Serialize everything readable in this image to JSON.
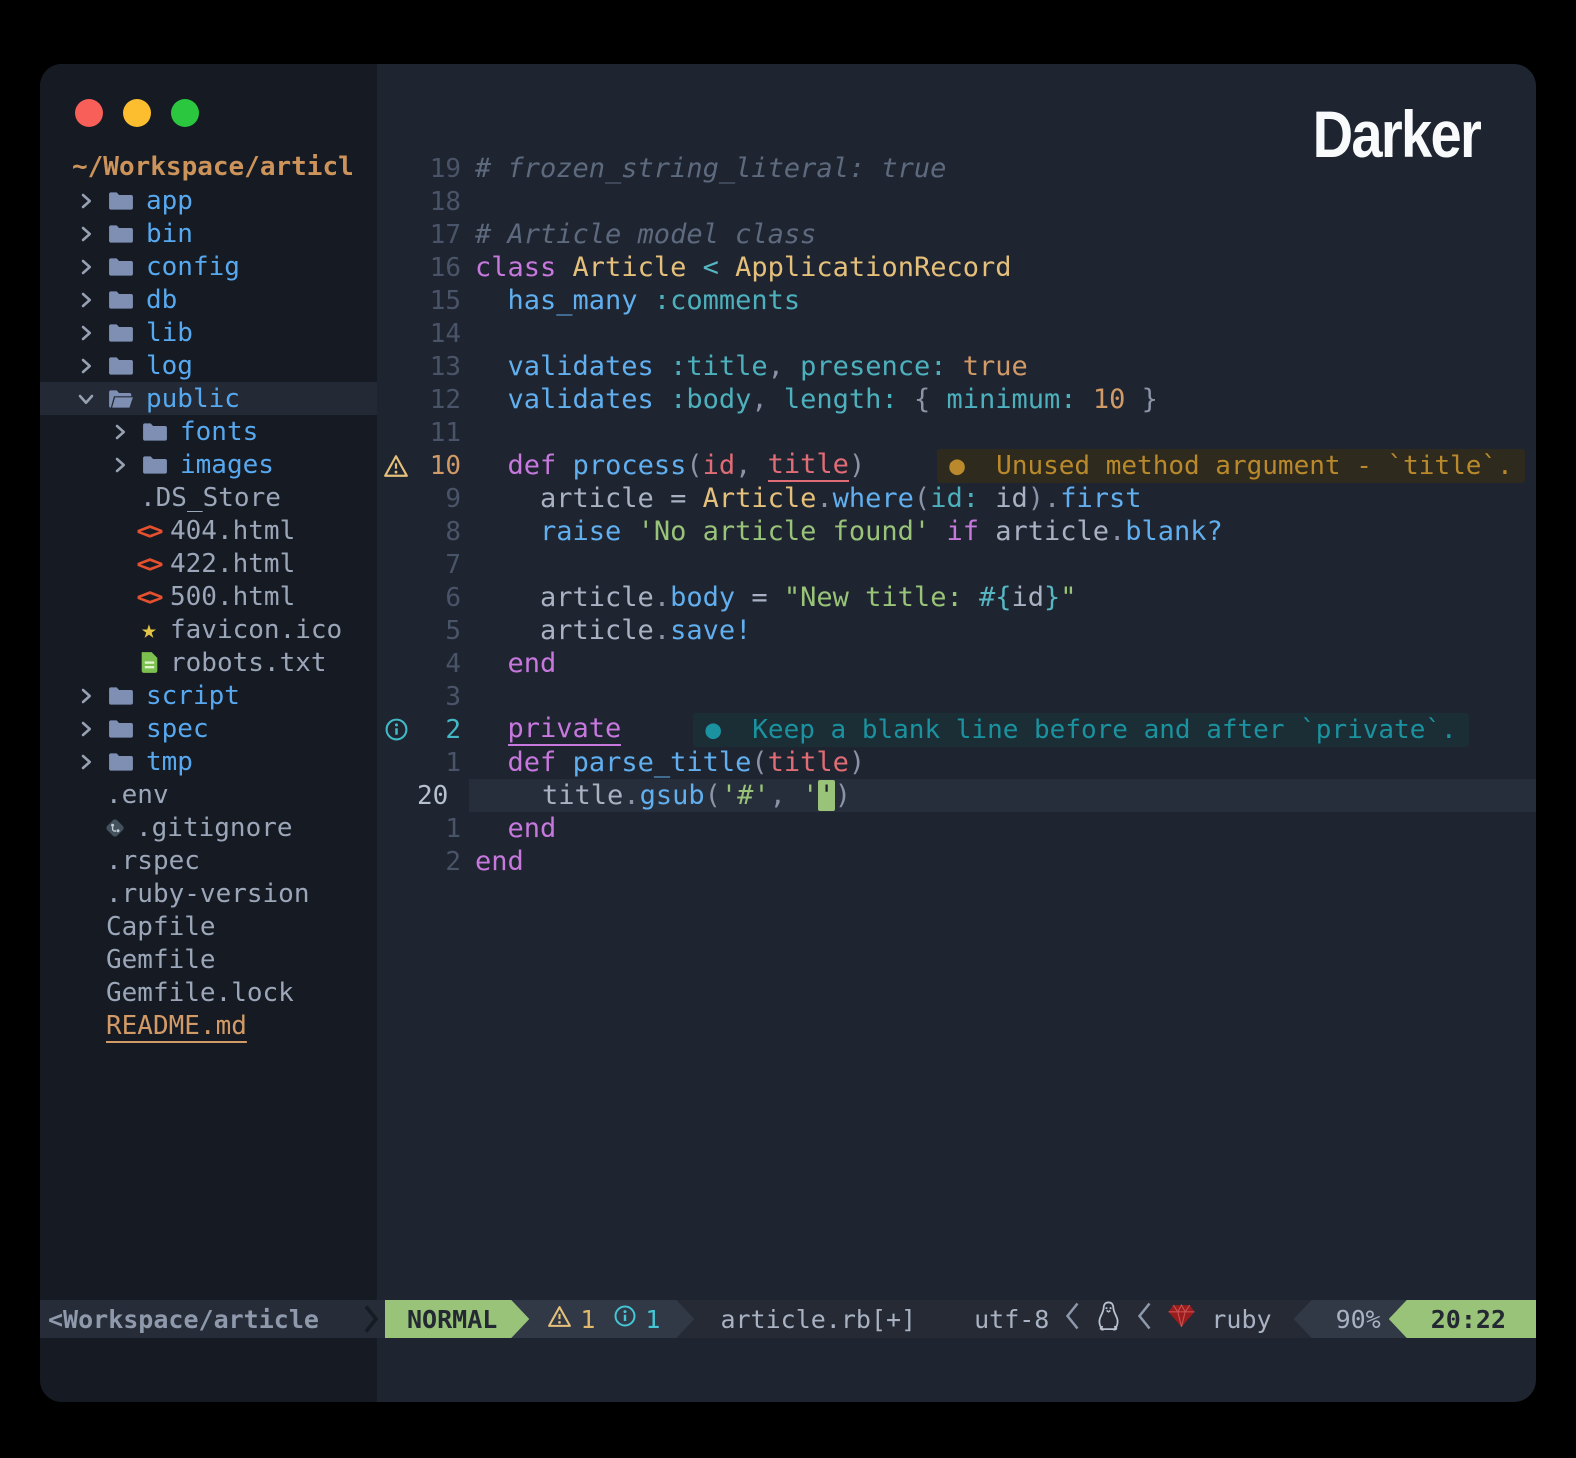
{
  "window": {
    "title": "Darker"
  },
  "colors": {
    "accent_green": "#98c379",
    "warning": "#e5c07b",
    "info": "#41bac8",
    "error_red": "#e06c75",
    "folder_blue": "#57a8ee",
    "ruby_red": "#9b1c1c",
    "root_orange": "#cc935a"
  },
  "sidebar": {
    "root": "~/Workspace/articl",
    "items": [
      {
        "label": "app",
        "kind": "folder",
        "depth": 1
      },
      {
        "label": "bin",
        "kind": "folder",
        "depth": 1
      },
      {
        "label": "config",
        "kind": "folder",
        "depth": 1
      },
      {
        "label": "db",
        "kind": "folder",
        "depth": 1
      },
      {
        "label": "lib",
        "kind": "folder",
        "depth": 1
      },
      {
        "label": "log",
        "kind": "folder",
        "depth": 1
      },
      {
        "label": "public",
        "kind": "folder-open",
        "depth": 1,
        "selected": true
      },
      {
        "label": "fonts",
        "kind": "folder",
        "depth": 2
      },
      {
        "label": "images",
        "kind": "folder",
        "depth": 2
      },
      {
        "label": ".DS_Store",
        "kind": "file",
        "icon": "none",
        "depth": 2
      },
      {
        "label": "404.html",
        "kind": "file",
        "icon": "html",
        "depth": 2
      },
      {
        "label": "422.html",
        "kind": "file",
        "icon": "html",
        "depth": 2
      },
      {
        "label": "500.html",
        "kind": "file",
        "icon": "html",
        "depth": 2
      },
      {
        "label": "favicon.ico",
        "kind": "file",
        "icon": "star",
        "depth": 2
      },
      {
        "label": "robots.txt",
        "kind": "file",
        "icon": "doc",
        "depth": 2
      },
      {
        "label": "script",
        "kind": "folder",
        "depth": 1
      },
      {
        "label": "spec",
        "kind": "folder",
        "depth": 1
      },
      {
        "label": "tmp",
        "kind": "folder",
        "depth": 1
      },
      {
        "label": ".env",
        "kind": "file",
        "icon": "none",
        "depth": 0
      },
      {
        "label": ".gitignore",
        "kind": "file",
        "icon": "git",
        "depth": 0
      },
      {
        "label": ".rspec",
        "kind": "file",
        "icon": "none",
        "depth": 0
      },
      {
        "label": ".ruby-version",
        "kind": "file",
        "icon": "none",
        "depth": 0
      },
      {
        "label": "Capfile",
        "kind": "file",
        "icon": "none",
        "depth": 0
      },
      {
        "label": "Gemfile",
        "kind": "file",
        "icon": "none",
        "depth": 0
      },
      {
        "label": "Gemfile.lock",
        "kind": "file",
        "icon": "none",
        "depth": 0
      },
      {
        "label": "README.md",
        "kind": "file",
        "icon": "none",
        "depth": 0,
        "accent": true
      }
    ]
  },
  "editor": {
    "vt_bullet": "●",
    "lines": [
      {
        "n": "19",
        "t": [
          [
            "cm",
            "# frozen_string_literal: true"
          ]
        ]
      },
      {
        "n": "18",
        "t": []
      },
      {
        "n": "17",
        "t": [
          [
            "cm",
            "# Article model class"
          ]
        ]
      },
      {
        "n": "16",
        "t": [
          [
            "kw",
            "class"
          ],
          [
            "fg",
            " "
          ],
          [
            "const",
            "Article"
          ],
          [
            "fg",
            " "
          ],
          [
            "op",
            "<"
          ],
          [
            "fg",
            " "
          ],
          [
            "const",
            "ApplicationRecord"
          ]
        ]
      },
      {
        "n": "15",
        "t": [
          [
            "fg",
            "  "
          ],
          [
            "fn",
            "has_many"
          ],
          [
            "fg",
            " "
          ],
          [
            "sym",
            ":comments"
          ]
        ]
      },
      {
        "n": "14",
        "t": []
      },
      {
        "n": "13",
        "t": [
          [
            "fg",
            "  "
          ],
          [
            "fn",
            "validates"
          ],
          [
            "fg",
            " "
          ],
          [
            "sym",
            ":title"
          ],
          [
            "pu",
            ","
          ],
          [
            "fg",
            " "
          ],
          [
            "sym",
            "presence:"
          ],
          [
            "fg",
            " "
          ],
          [
            "num",
            "true"
          ]
        ]
      },
      {
        "n": "12",
        "t": [
          [
            "fg",
            "  "
          ],
          [
            "fn",
            "validates"
          ],
          [
            "fg",
            " "
          ],
          [
            "sym",
            ":body"
          ],
          [
            "pu",
            ","
          ],
          [
            "fg",
            " "
          ],
          [
            "sym",
            "length:"
          ],
          [
            "fg",
            " "
          ],
          [
            "pu",
            "{"
          ],
          [
            "fg",
            " "
          ],
          [
            "sym",
            "minimum:"
          ],
          [
            "fg",
            " "
          ],
          [
            "num",
            "10"
          ],
          [
            "fg",
            " "
          ],
          [
            "pu",
            "}"
          ]
        ]
      },
      {
        "n": "11",
        "t": []
      },
      {
        "n": "10",
        "sign": "warn",
        "nclass": "warn",
        "t": [
          [
            "fg",
            "  "
          ],
          [
            "kw",
            "def"
          ],
          [
            "fg",
            " "
          ],
          [
            "fn",
            "process"
          ],
          [
            "pu",
            "("
          ],
          [
            "arg",
            "id"
          ],
          [
            "pu",
            ", "
          ],
          [
            "argu",
            "title"
          ],
          [
            "pu",
            ")"
          ]
        ],
        "vt": {
          "type": "warn",
          "text": "Unused method argument - `title`."
        }
      },
      {
        "n": "9",
        "t": [
          [
            "fg",
            "    article = "
          ],
          [
            "const",
            "Article"
          ],
          [
            "pu",
            "."
          ],
          [
            "fn",
            "where"
          ],
          [
            "pu",
            "("
          ],
          [
            "sym",
            "id:"
          ],
          [
            "fg",
            " id"
          ],
          [
            "pu",
            ")."
          ],
          [
            "fn",
            "first"
          ]
        ]
      },
      {
        "n": "8",
        "t": [
          [
            "fg",
            "    "
          ],
          [
            "fn",
            "raise"
          ],
          [
            "fg",
            " "
          ],
          [
            "str",
            "'No article found'"
          ],
          [
            "fg",
            " "
          ],
          [
            "kw",
            "if"
          ],
          [
            "fg",
            " article"
          ],
          [
            "pu",
            "."
          ],
          [
            "fn",
            "blank?"
          ]
        ]
      },
      {
        "n": "7",
        "t": []
      },
      {
        "n": "6",
        "t": [
          [
            "fg",
            "    article"
          ],
          [
            "pu",
            "."
          ],
          [
            "fn",
            "body"
          ],
          [
            "fg",
            " = "
          ],
          [
            "str",
            "\"New title: "
          ],
          [
            "op",
            "#{"
          ],
          [
            "fg",
            "id"
          ],
          [
            "op",
            "}"
          ],
          [
            "str",
            "\""
          ]
        ]
      },
      {
        "n": "5",
        "t": [
          [
            "fg",
            "    article"
          ],
          [
            "pu",
            "."
          ],
          [
            "fn",
            "save!"
          ]
        ]
      },
      {
        "n": "4",
        "t": [
          [
            "fg",
            "  "
          ],
          [
            "kw",
            "end"
          ]
        ]
      },
      {
        "n": "3",
        "t": []
      },
      {
        "n": "2",
        "sign": "info",
        "nclass": "info",
        "t": [
          [
            "fg",
            "  "
          ],
          [
            "kwu",
            "private"
          ]
        ],
        "vt": {
          "type": "info",
          "text": "Keep a blank line before and after `private`."
        }
      },
      {
        "n": "1",
        "t": [
          [
            "fg",
            "  "
          ],
          [
            "kw",
            "def"
          ],
          [
            "fg",
            " "
          ],
          [
            "fn",
            "parse_title"
          ],
          [
            "pu",
            "("
          ],
          [
            "arg",
            "title"
          ],
          [
            "pu",
            ")"
          ]
        ]
      },
      {
        "n": "20",
        "current": true,
        "t": [
          [
            "fg",
            "    title"
          ],
          [
            "pu",
            "."
          ],
          [
            "fn",
            "gsub"
          ],
          [
            "pu",
            "("
          ],
          [
            "str",
            "'#'"
          ],
          [
            "pu",
            ", "
          ],
          [
            "str",
            "'"
          ],
          [
            "cur",
            "'"
          ],
          [
            "pu",
            ")"
          ]
        ]
      },
      {
        "n": "1",
        "t": [
          [
            "fg",
            "  "
          ],
          [
            "kw",
            "end"
          ]
        ]
      },
      {
        "n": "2",
        "t": [
          [
            "kw",
            "end"
          ]
        ]
      }
    ]
  },
  "statusbar": {
    "tree_path": "<Workspace/article",
    "mode": "NORMAL",
    "warn_count": "1",
    "info_count": "1",
    "file": "article.rb[+]",
    "encoding": "utf-8",
    "lang": "ruby",
    "percent": "90%",
    "time": "20:22"
  }
}
